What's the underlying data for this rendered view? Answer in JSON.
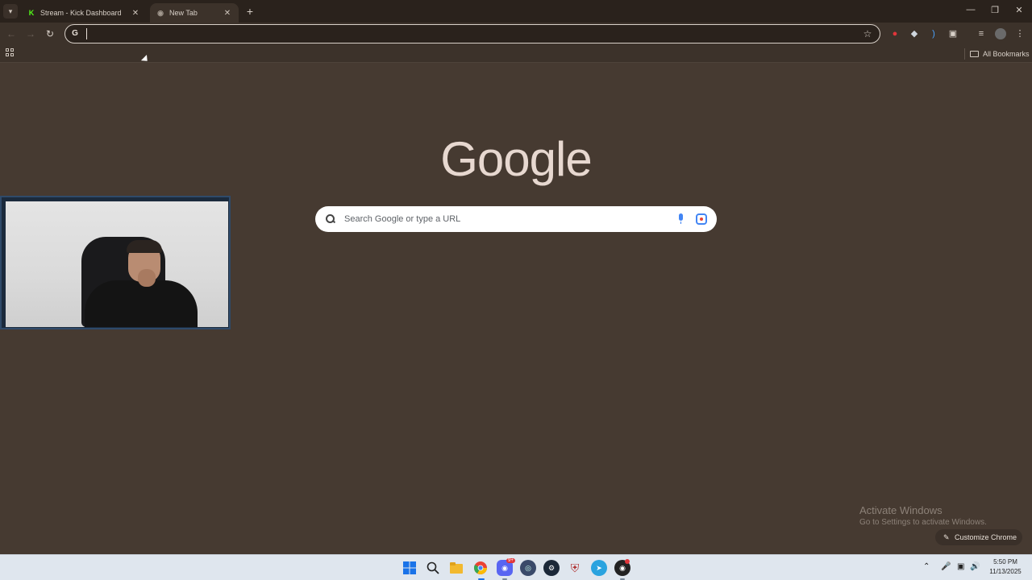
{
  "browser": {
    "tabs": [
      {
        "label": "Stream - Kick Dashboard",
        "favicon": "kick-icon",
        "active": false
      },
      {
        "label": "New Tab",
        "favicon": "new-tab-icon",
        "active": true
      }
    ],
    "omnibox": {
      "value": "",
      "placeholder": ""
    },
    "bookmarks": {
      "all_bookmarks_label": "All Bookmarks"
    }
  },
  "ntp": {
    "logo_text": "Google",
    "search": {
      "placeholder": "Search Google or type a URL"
    },
    "customize_label": "Customize Chrome"
  },
  "watermark": {
    "title": "Activate Windows",
    "subtitle": "Go to Settings to activate Windows."
  },
  "taskbar": {
    "apps": [
      "start-icon",
      "search-icon",
      "file-explorer-icon",
      "chrome-icon",
      "discord-icon",
      "browser-icon",
      "steam-icon",
      "shield-app-icon",
      "telegram-icon",
      "obs-icon"
    ],
    "discord_badge": "9+",
    "clock": {
      "time": "5:50 PM",
      "date": "11/13/2025"
    }
  },
  "colors": {
    "background": "#463a31",
    "tabstrip": "#2a221c",
    "accent": "#53fc18"
  }
}
